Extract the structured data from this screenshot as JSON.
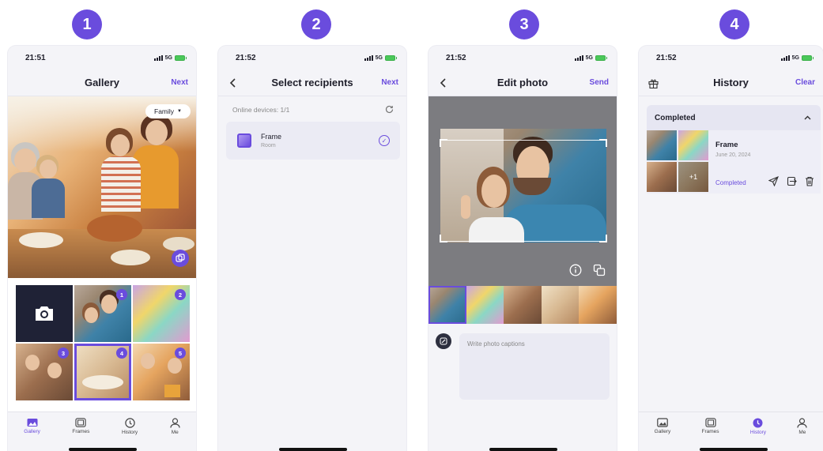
{
  "steps": [
    "1",
    "2",
    "3",
    "4"
  ],
  "status": {
    "time_1": "21:51",
    "time_2": "21:52",
    "time_3": "21:52",
    "time_4": "21:52",
    "network": "5G"
  },
  "phone1": {
    "title": "Gallery",
    "action": "Next",
    "album_filter": "Family",
    "grid_badges": [
      "1",
      "2",
      "3",
      "4",
      "5"
    ]
  },
  "phone2": {
    "title": "Select recipients",
    "action": "Next",
    "online_devices": "Online devices: 1/1",
    "device": {
      "name": "Frame",
      "location": "Room"
    }
  },
  "phone3": {
    "title": "Edit photo",
    "action": "Send",
    "caption_placeholder": "Write photo captions"
  },
  "phone4": {
    "title": "History",
    "action": "Clear",
    "section": "Completed",
    "item": {
      "name": "Frame",
      "date": "June 20, 2024",
      "status": "Completed",
      "more_count": "+1"
    }
  },
  "tabs": [
    "Gallery",
    "Frames",
    "History",
    "Me"
  ],
  "colors": {
    "accent": "#6a4cdd",
    "background": "#f4f4f8"
  },
  "icons": [
    "back-icon",
    "refresh-icon",
    "check-icon",
    "info-icon",
    "layers-icon",
    "gift-icon",
    "send-icon",
    "export-icon",
    "trash-icon",
    "camera-icon"
  ]
}
